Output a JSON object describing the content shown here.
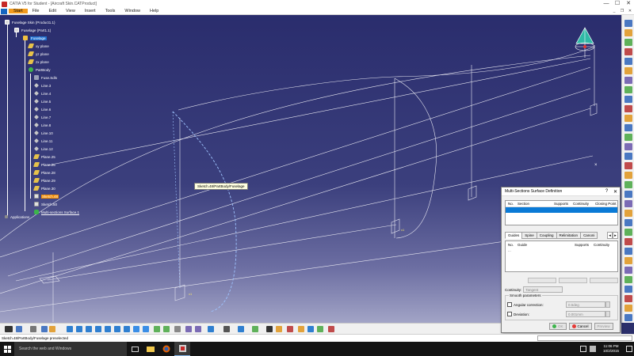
{
  "window": {
    "title": "CATIA V5 for Student - [Aircraft Skin.CATProduct]",
    "min": "—",
    "max": "☐",
    "close": "✕"
  },
  "menu": [
    "Start",
    "File",
    "Edit",
    "View",
    "Insert",
    "Tools",
    "Window",
    "Help"
  ],
  "tree": [
    {
      "label": "Fuselage Skin (Product1.1)",
      "state": ""
    },
    {
      "label": "Fuselage (Part1.1)",
      "state": ""
    },
    {
      "label": "Fuselage",
      "state": "selected"
    },
    {
      "label": "xy plane",
      "state": ""
    },
    {
      "label": "yz plane",
      "state": ""
    },
    {
      "label": "zx plane",
      "state": ""
    },
    {
      "label": "PartBody",
      "state": ""
    },
    {
      "label": "Fuse.Sdls",
      "state": ""
    },
    {
      "label": "Line.3",
      "state": ""
    },
    {
      "label": "Line.4",
      "state": ""
    },
    {
      "label": "Line.5",
      "state": ""
    },
    {
      "label": "Line.6",
      "state": ""
    },
    {
      "label": "Line.7",
      "state": ""
    },
    {
      "label": "Line.8",
      "state": ""
    },
    {
      "label": "Line.10",
      "state": ""
    },
    {
      "label": "Line.11",
      "state": ""
    },
    {
      "label": "Line.12",
      "state": ""
    },
    {
      "label": "Plane.25",
      "state": ""
    },
    {
      "label": "Plane.26",
      "state": ""
    },
    {
      "label": "Plane.28",
      "state": ""
    },
    {
      "label": "Plane.29",
      "state": ""
    },
    {
      "label": "Plane.30",
      "state": ""
    },
    {
      "label": "Sketch.48",
      "state": "highlight"
    },
    {
      "label": "Sketch.50",
      "state": ""
    },
    {
      "label": "Multi-sections Surface.1",
      "state": "underline"
    },
    {
      "label": "Applications",
      "state": ""
    }
  ],
  "tooltip": "Sketch.48/PartBody/Fuselage",
  "dialog": {
    "title": "Multi-Sections Surface Definition",
    "help": "?",
    "close": "✕",
    "section_cols": [
      "No.",
      "Section",
      "Supports",
      "Continuity",
      "Closing Point"
    ],
    "tabs": [
      "Guides",
      "Spine",
      "Coupling",
      "Relimitation",
      "Canoni"
    ],
    "tab_arrows": [
      "◂",
      "▸"
    ],
    "guide_cols": [
      "No.",
      "Guide",
      "Supports",
      "Continuity"
    ],
    "guide_rows": [
      "..."
    ],
    "continuity_label": "Continuity:",
    "continuity_value": "Tangent",
    "smooth_label": "Smooth parameters",
    "angular_label": "Angular correction:",
    "angular_value": "0.5deg",
    "deviation_label": "Deviation:",
    "deviation_value": "0.001mm",
    "ok": "OK",
    "cancel": "Cancel",
    "preview": "Preview"
  },
  "status": "Sketch.48/PartBody/Fuselage preselected",
  "taskbar": {
    "search": "Search the web and Windows",
    "time": "11:06 PM",
    "date": "10/2/2015"
  },
  "colors": {
    "accent_orange": "#f08a00",
    "selection_blue": "#1e6fd0",
    "dialog_select": "#0a7ad6"
  }
}
